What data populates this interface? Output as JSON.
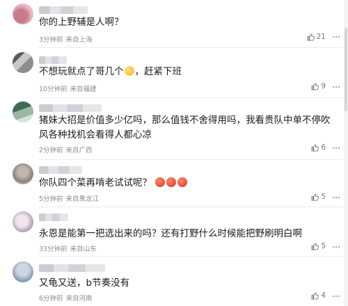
{
  "comments": [
    {
      "text": "你的上野辅是人啊？",
      "time": "3分钟前",
      "location": "来自上海",
      "likes": "21"
    },
    {
      "text_before": "不想玩就点了哥几个",
      "text_after": "，赶紧下班",
      "time": "10分钟前",
      "location": "来自福建",
      "likes": "9"
    },
    {
      "text": "猪妹大招是价值多少亿吗，那么值钱不舍得用吗，我看贵队中单不停吹风各种找机会看得人都心凉",
      "time": "2分钟前",
      "location": "来自广西",
      "likes": "6"
    },
    {
      "text": "你队四个菜再啃老试试呢？",
      "time": "5分钟前",
      "location": "来自黑龙江",
      "likes": "5"
    },
    {
      "text": "永恩是能第一把选出来的吗？还有打野什么时候能把野刷明白啊",
      "time": "33分钟前",
      "location": "来自山东",
      "likes": "5"
    },
    {
      "text": "又龟又送，b节奏没有",
      "time": "6分钟前",
      "location": "来自河南",
      "likes": "4"
    }
  ],
  "icons": {
    "like": "thumbs-up-icon",
    "more": "more-dots-icon",
    "emoji_smile": "smile-emoji-icon",
    "emoji_tomato": "tomato-emoji-icon"
  },
  "colors": {
    "text": "#1b1b1b",
    "meta": "#8c8c8c",
    "divider": "#ececec"
  }
}
